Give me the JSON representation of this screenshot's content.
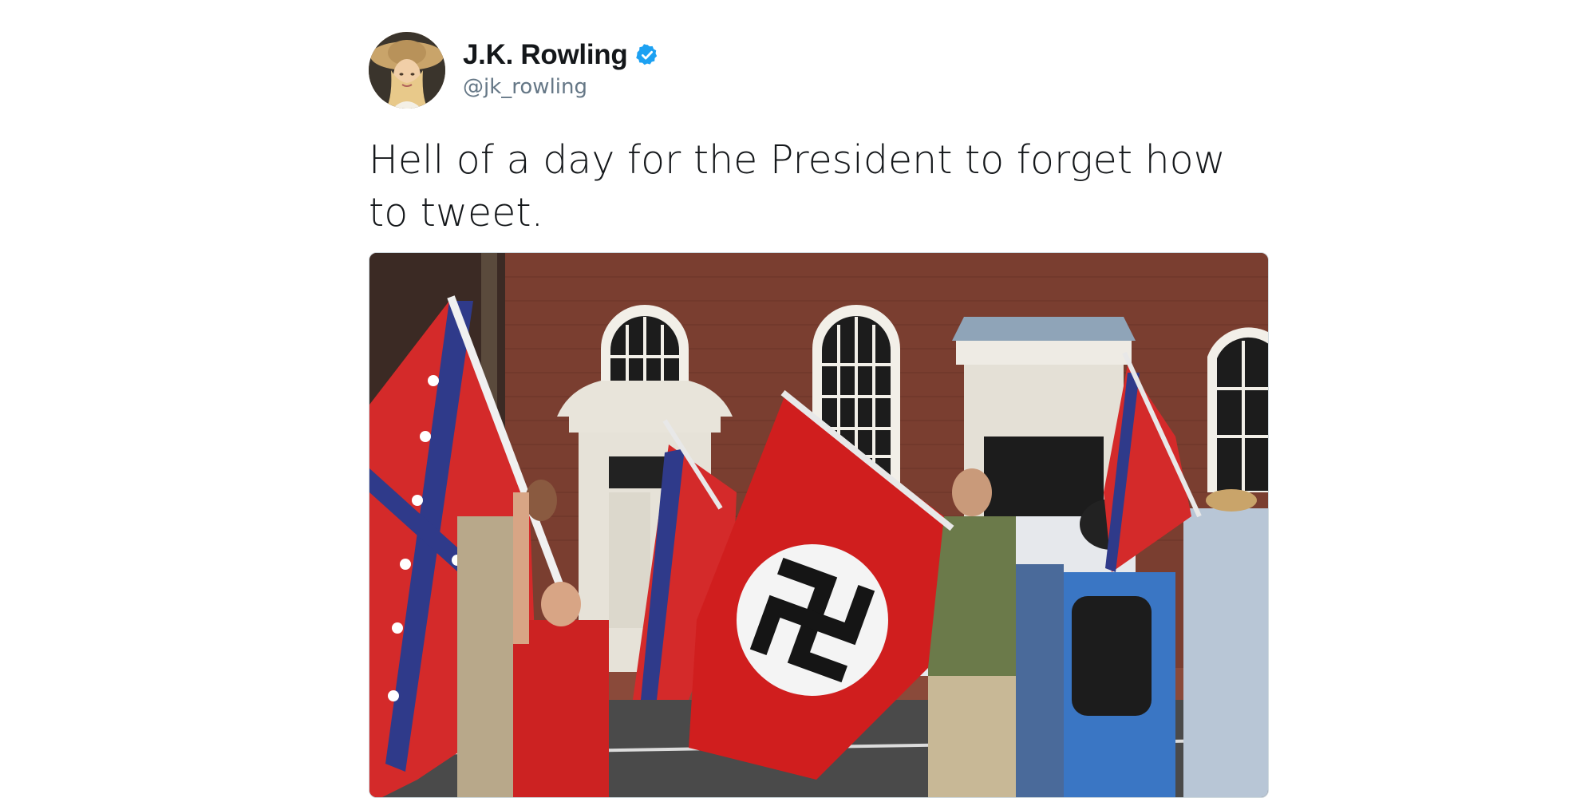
{
  "author": {
    "display_name": "J.K. Rowling",
    "handle": "@jk_rowling",
    "verified": true,
    "avatar_icon": "profile-photo"
  },
  "tweet": {
    "text": "Hell of a day for the President to forget how to tweet."
  },
  "media": {
    "type": "photo"
  },
  "colors": {
    "verified_blue": "#1da1f2",
    "text_primary": "#14171a",
    "text_secondary": "#657786"
  }
}
